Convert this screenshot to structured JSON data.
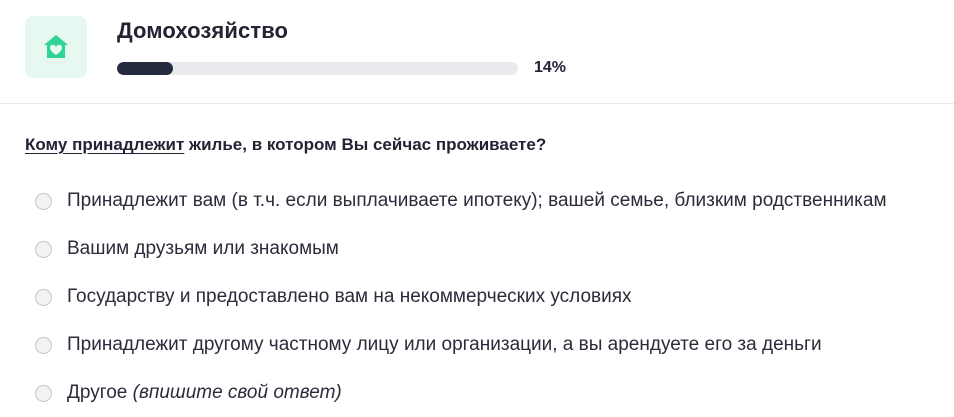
{
  "header": {
    "icon": "house-heart-icon",
    "icon_color": "#2fd394",
    "icon_bg": "#e7f8f1",
    "title": "Домохозяйство",
    "progress_fraction": 0.14,
    "progress_label": "14%",
    "progress_color": "#252a3f"
  },
  "question": {
    "term": "Кому принадлежит",
    "rest": " жилье, в котором Вы сейчас проживаете?"
  },
  "options": [
    {
      "label": "Принадлежит вам (в т.ч. если выплачиваете ипотеку); вашей семье, близким родственникам",
      "selected": false
    },
    {
      "label": "Вашим друзьям или знакомым",
      "selected": false
    },
    {
      "label": "Государству и предоставлено вам на некоммерческих условиях",
      "selected": false
    },
    {
      "label": "Принадлежит другому частному лицу или организации, а вы арендуете его за деньги",
      "selected": false
    },
    {
      "label": "Другое ",
      "hint": "(впишите свой ответ)",
      "selected": false
    }
  ]
}
